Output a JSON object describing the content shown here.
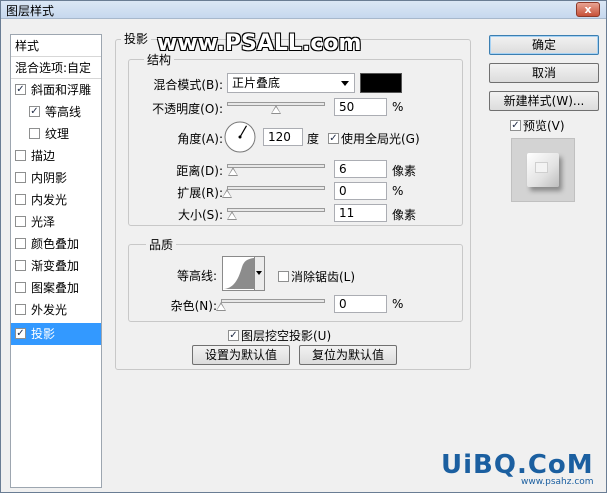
{
  "window": {
    "title": "图层样式",
    "close": "x"
  },
  "stylelist": {
    "items": [
      {
        "label": "样式",
        "check": ""
      },
      {
        "label": "混合选项:自定",
        "check": ""
      },
      {
        "label": "斜面和浮雕",
        "check": "✓"
      },
      {
        "label": "等高线",
        "check": "✓"
      },
      {
        "label": "纹理",
        "check": ""
      },
      {
        "label": "描边",
        "check": ""
      },
      {
        "label": "内阴影",
        "check": ""
      },
      {
        "label": "内发光",
        "check": ""
      },
      {
        "label": "光泽",
        "check": ""
      },
      {
        "label": "颜色叠加",
        "check": ""
      },
      {
        "label": "渐变叠加",
        "check": ""
      },
      {
        "label": "图案叠加",
        "check": ""
      },
      {
        "label": "外发光",
        "check": ""
      },
      {
        "label": "投影",
        "check": "✓"
      }
    ]
  },
  "panel": {
    "title": "投影",
    "structure": {
      "title": "结构",
      "blend_mode_label": "混合模式(B):",
      "blend_mode_value": "正片叠底",
      "shadow_color": "#000000",
      "opacity_label": "不透明度(O):",
      "opacity_value": "50",
      "opacity_level": 0.5,
      "percent": "%",
      "angle_label": "角度(A):",
      "angle_value": "120",
      "angle_unit": "度",
      "global_light_label": "使用全局光(G)",
      "global_light_check": "✓",
      "distance_label": "距离(D):",
      "distance_value": "6",
      "distance_level": 0.06,
      "pixels": "像素",
      "spread_label": "扩展(R):",
      "spread_value": "0",
      "spread_level": 0.0,
      "size_label": "大小(S):",
      "size_value": "11",
      "size_level": 0.05
    },
    "quality": {
      "title": "品质",
      "contour_label": "等高线:",
      "antialias_label": "消除锯齿(L)",
      "antialias_check": "",
      "noise_label": "杂色(N):",
      "noise_value": "0",
      "noise_level": 0.0,
      "percent": "%"
    },
    "knockout_label": "图层挖空投影(U)",
    "knockout_check": "✓",
    "make_default": "设置为默认值",
    "reset_default": "复位为默认值"
  },
  "buttons": {
    "ok": "确定",
    "cancel": "取消",
    "new_style": "新建样式(W)...",
    "preview_label": "预览(V)",
    "preview_check": "✓"
  },
  "watermarks": {
    "top": "www.PSALL.com",
    "bottom": "UiBQ.CoM",
    "bottom_small": "www.psahz.com"
  }
}
